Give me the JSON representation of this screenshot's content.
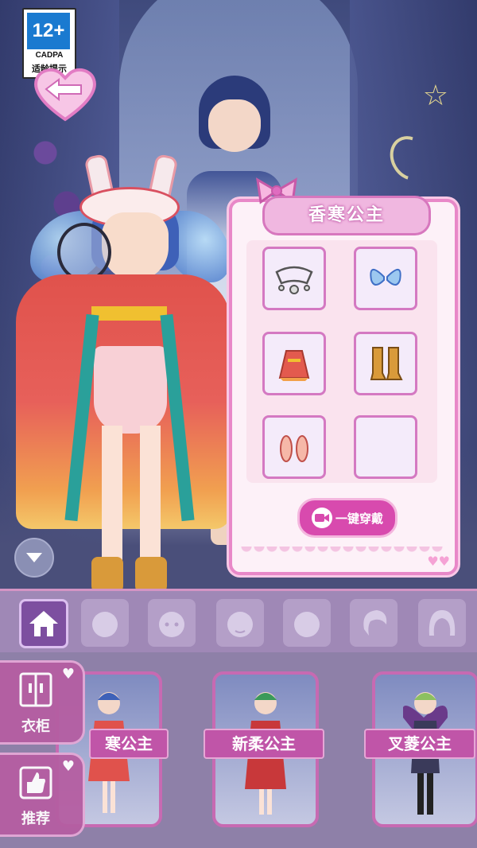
{
  "age_badge": {
    "rating": "12+",
    "org": "CADPA",
    "tip": "适龄提示"
  },
  "outfit_panel": {
    "title": "香寒公主",
    "wear_all_label": "一键穿戴",
    "slots": [
      {
        "item": "headpiece",
        "icon": "tiara-icon"
      },
      {
        "item": "wings",
        "icon": "wings-icon"
      },
      {
        "item": "dress",
        "icon": "dress-icon"
      },
      {
        "item": "boots",
        "icon": "boots-icon"
      },
      {
        "item": "shoes",
        "icon": "shoes-icon"
      },
      {
        "item": "empty",
        "icon": ""
      }
    ]
  },
  "tabs": [
    {
      "name": "home",
      "icon": "house-icon",
      "active": true
    },
    {
      "name": "face-1",
      "icon": "face-icon",
      "active": false
    },
    {
      "name": "face-2",
      "icon": "face-icon",
      "active": false
    },
    {
      "name": "face-3",
      "icon": "face-icon",
      "active": false
    },
    {
      "name": "face-4",
      "icon": "face-icon",
      "active": false
    },
    {
      "name": "hair-1",
      "icon": "hair-icon",
      "active": false
    },
    {
      "name": "hair-2",
      "icon": "hair-icon",
      "active": false
    }
  ],
  "side_buttons": {
    "wardrobe": "衣柜",
    "recommend": "推荐"
  },
  "outfit_cards": [
    {
      "name": "寒公主"
    },
    {
      "name": "新柔公主"
    },
    {
      "name": "叉菱公主"
    }
  ],
  "colors": {
    "accent_pink": "#d84aae",
    "panel_border": "#e888c8",
    "tab_active": "#7d4fa0"
  }
}
